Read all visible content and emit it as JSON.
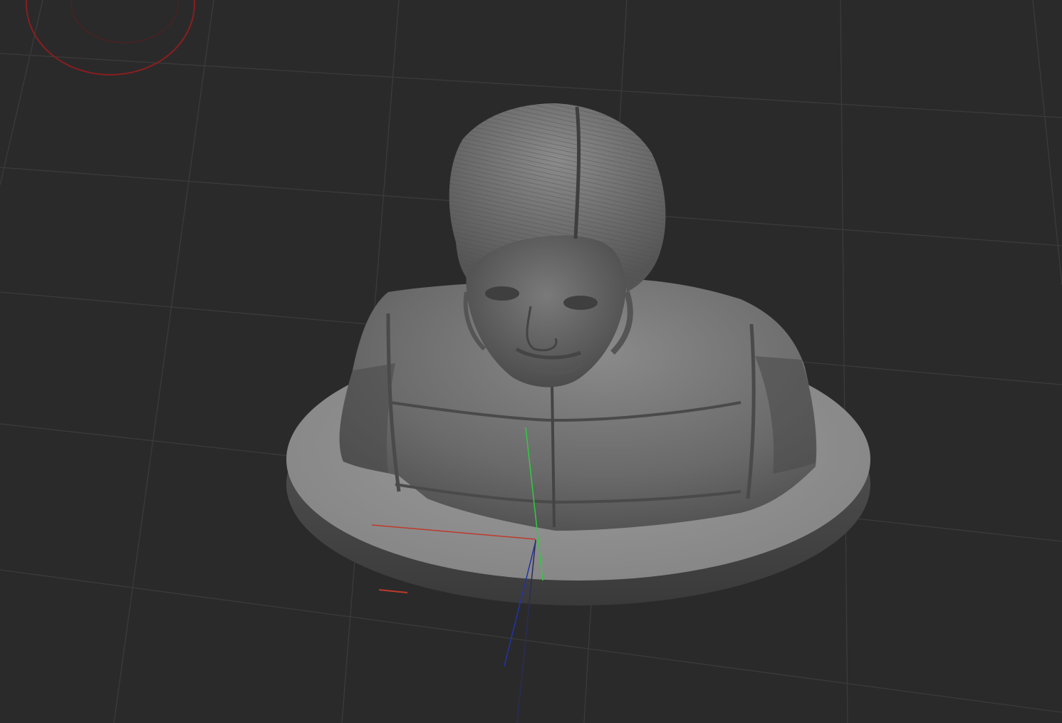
{
  "viewport": {
    "background": "#2a2a2b",
    "grid_color": "#3c3c3d",
    "axis_colors": {
      "x": "#c0392b",
      "y": "#2ecc40",
      "z": "#2233aa"
    },
    "gizmo_color": "#8a1e1e"
  },
  "model": {
    "name": "",
    "base_color": "#8c8c8c",
    "sculpt_color": "#6a6a6a"
  },
  "icons": {
    "rotation_gizmo": "rotation-ring-icon"
  }
}
